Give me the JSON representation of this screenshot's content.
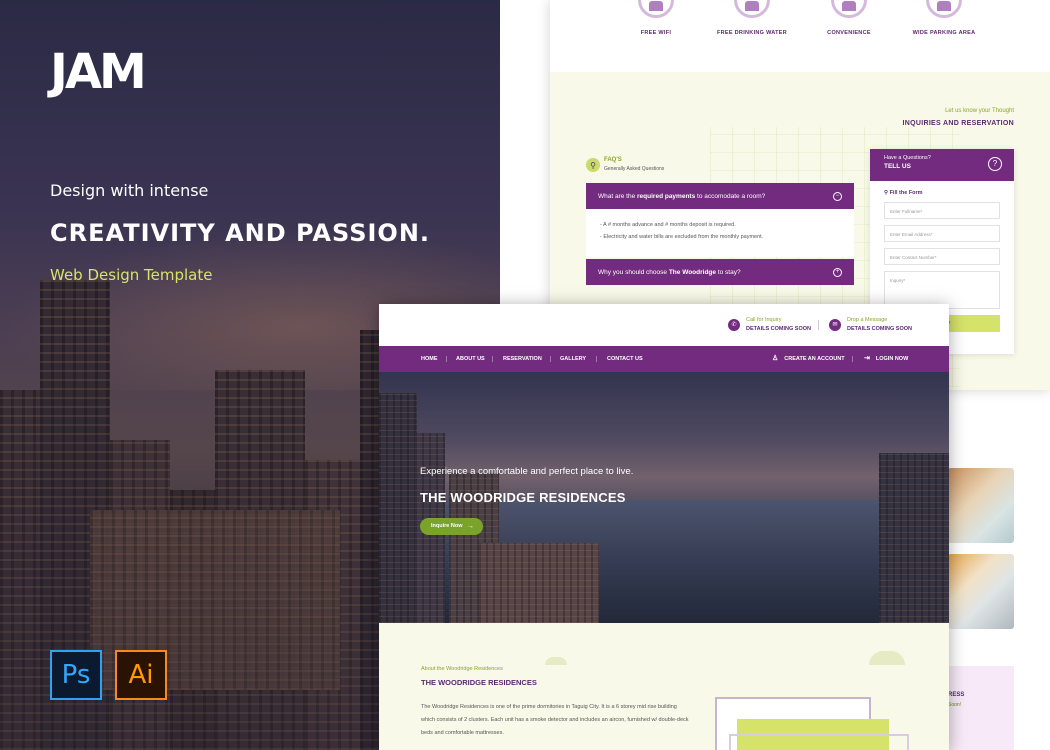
{
  "promo": {
    "logo": "JAM",
    "tagline_intro": "Design with intense",
    "tagline_main": "CREATIVITY AND PASSION.",
    "tagline_type": "Web Design Template",
    "tools": [
      {
        "label": "Ps",
        "name": "photoshop",
        "color": "#31a8ff"
      },
      {
        "label": "Ai",
        "name": "illustrator",
        "color": "#ff9a00"
      }
    ]
  },
  "back_mock": {
    "amenities": [
      "FREE WIFI",
      "FREE DRINKING WATER",
      "CONVENIENCE",
      "WIDE PARKING AREA"
    ],
    "inquiries": {
      "subtitle": "Let us know your Thought",
      "title": "INQUIRIES AND RESERVATION"
    },
    "faq": {
      "heading": "FAQ'S",
      "subheading": "Generally Asked Questions",
      "items": [
        {
          "question_prefix": "What are the ",
          "question_strong": "required payments",
          "question_suffix": " to accomodate a room?",
          "expanded": true,
          "answers": [
            "- A # months advance and # months deposit is required.",
            "- Electricity and water bills are excluded from the monthly payment."
          ]
        },
        {
          "question_prefix": "Why you should choose ",
          "question_strong": "The Woodridge",
          "question_suffix": " to stay?",
          "expanded": false
        }
      ]
    },
    "tell_us": {
      "small": "Have a Questions?",
      "big": "TELL US",
      "form_label": "Fill the Form",
      "fields": {
        "fullname": "Enter Fullname*",
        "email": "Enter Email Address*",
        "contact": "Enter Contact Number*",
        "inquiry": "Inquiry*"
      },
      "submit_label": "Inquiry"
    },
    "side_band": {
      "title": "RESS",
      "subtitle": "Soon!"
    }
  },
  "front_mock": {
    "contact": [
      {
        "small": "Call for Inquiry",
        "bold": "DETAILS COMING SOON",
        "icon": "phone-icon"
      },
      {
        "small": "Drop a Message",
        "bold": "DETAILS COMING SOON",
        "icon": "mail-icon"
      }
    ],
    "nav": {
      "links": [
        "HOME",
        "ABOUT US",
        "RESERVATION",
        "GALLERY",
        "CONTACT US"
      ],
      "create_account": "CREATE AN ACCOUNT",
      "login": "LOGIN NOW"
    },
    "hero": {
      "subtitle": "Experience a comfortable and perfect place to live.",
      "title": "THE WOODRIDGE RESIDENCES",
      "button": "Inquire Now"
    },
    "about": {
      "subtitle": "About the Woodridge Residences",
      "title": "THE WOODRIDGE RESIDENCES",
      "body": "The Woodridge Residences is one of the prime dormitories in Taguig City. It is a 6 storey mid rise building which consists of 2 clusters. Each unit has a smoke detector and includes an aircon, furnished w/ double-deck beds and comfortable mattresses."
    }
  },
  "colors": {
    "brand_purple": "#722b7e",
    "accent_lime": "#d5e36a",
    "accent_green": "#7aa32a",
    "cream": "#f8f9e8"
  }
}
